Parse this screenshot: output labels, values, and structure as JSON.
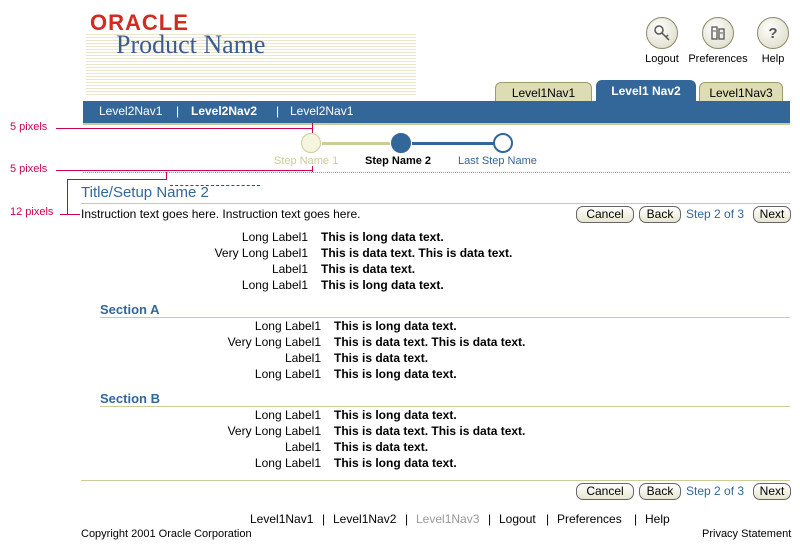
{
  "branding": {
    "logo_text": "ORACLE",
    "product_name": "Product Name"
  },
  "global_buttons": [
    {
      "label": "Logout",
      "icon": "logout-icon"
    },
    {
      "label": "Preferences",
      "icon": "preferences-icon"
    },
    {
      "label": "Help",
      "icon": "help-icon",
      "glyph": "?"
    }
  ],
  "level1_tabs": [
    {
      "label": "Level1Nav1",
      "active": false
    },
    {
      "label": "Level1 Nav2",
      "active": true
    },
    {
      "label": "Level1Nav3",
      "active": false
    }
  ],
  "level2_nav": [
    {
      "label": "Level2Nav1",
      "selected": false
    },
    {
      "label": "Level2Nav2",
      "selected": true
    },
    {
      "label": "Level2Nav1",
      "selected": false
    }
  ],
  "separator": "|",
  "train": [
    {
      "label": "Step Name 1",
      "state": "visited"
    },
    {
      "label": "Step Name 2",
      "state": "current"
    },
    {
      "label": "Last Step Name",
      "state": "next"
    }
  ],
  "annotations": [
    "5 pixels",
    "5 pixels",
    "12 pixels"
  ],
  "page_title": "Title/Setup Name 2",
  "instruction": "Instruction text goes here. Instruction text goes here.",
  "page_buttons": {
    "cancel": "Cancel",
    "back": "Back",
    "step": "Step 2 of 3",
    "next": "Next"
  },
  "main_fields": [
    {
      "label": "Long Label1",
      "value": "This is long data text."
    },
    {
      "label": "Very Long Label1",
      "value": "This is data text. This is data text."
    },
    {
      "label": "Label1",
      "value": "This is data text."
    },
    {
      "label": "Long Label1",
      "value": "This is long data text."
    }
  ],
  "sections": [
    {
      "title": "Section A",
      "fields": [
        {
          "label": "Long Label1",
          "value": "This is long data text."
        },
        {
          "label": "Very Long Label1",
          "value": "This is data text. This is data text."
        },
        {
          "label": "Label1",
          "value": "This is data text."
        },
        {
          "label": "Long Label1",
          "value": "This is long data text."
        }
      ]
    },
    {
      "title": "Section B",
      "fields": [
        {
          "label": "Long Label1",
          "value": "This is long data text."
        },
        {
          "label": "Very Long Label1",
          "value": "This is data text. This is data text."
        },
        {
          "label": "Label1",
          "value": "This is data text."
        },
        {
          "label": "Long Label1",
          "value": "This is long data text."
        }
      ]
    }
  ],
  "footer": {
    "links": [
      {
        "label": "Level1Nav1",
        "disabled": false
      },
      {
        "label": "Level1Nav2",
        "disabled": false
      },
      {
        "label": "Level1Nav3",
        "disabled": true
      },
      {
        "label": "Logout",
        "disabled": false
      },
      {
        "label": "Preferences",
        "disabled": false
      },
      {
        "label": "Help",
        "disabled": false
      }
    ],
    "copyright": "Copyright 2001 Oracle Corporation",
    "privacy": "Privacy Statement"
  },
  "colors": {
    "accent": "#336699",
    "brand_red": "#d42a20",
    "annotation": "#cc0055",
    "tan": "#cccc99",
    "disabled": "#999999"
  }
}
